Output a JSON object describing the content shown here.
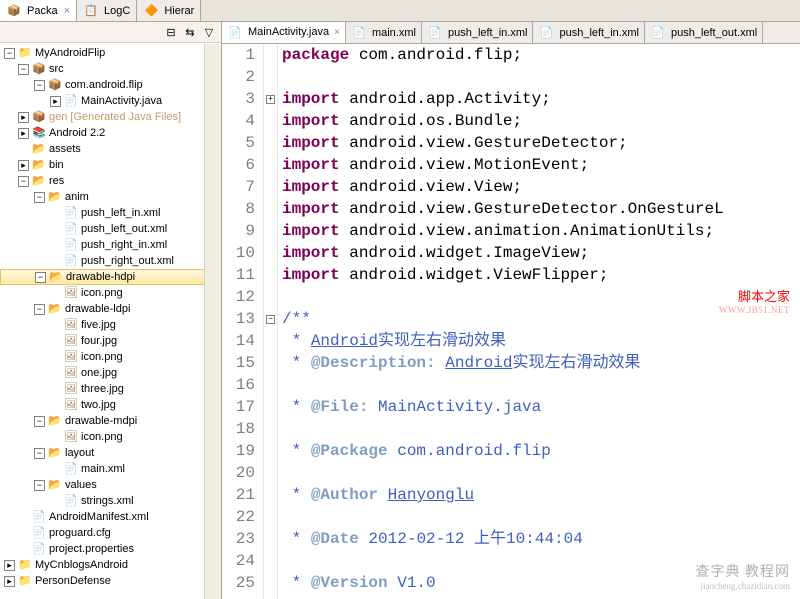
{
  "topTabs": [
    {
      "icon": "📦",
      "label": "Packa",
      "close": true
    },
    {
      "icon": "📋",
      "label": "LogC"
    },
    {
      "icon": "🔶",
      "label": "Hierar"
    }
  ],
  "tree": [
    {
      "d": 1,
      "exp": "-",
      "icon": "📁",
      "label": "MyAndroidFlip",
      "cls": "ico-proj"
    },
    {
      "d": 2,
      "exp": "-",
      "icon": "📦",
      "label": "src",
      "cls": "ico-pkg"
    },
    {
      "d": 3,
      "exp": "-",
      "icon": "📦",
      "label": "com.android.flip",
      "cls": "ico-pkg"
    },
    {
      "d": 4,
      "exp": ">",
      "icon": "📄",
      "label": "MainActivity.java",
      "cls": "ico-java"
    },
    {
      "d": 2,
      "exp": ">",
      "icon": "📦",
      "label": "gen [Generated Java Files]",
      "cls": "ico-pkg",
      "labelCls": "gen"
    },
    {
      "d": 2,
      "exp": ">",
      "icon": "📚",
      "label": "Android 2.2",
      "cls": "ico-folder"
    },
    {
      "d": 2,
      "exp": "",
      "icon": "📂",
      "label": "assets",
      "cls": "ico-folder"
    },
    {
      "d": 2,
      "exp": ">",
      "icon": "📂",
      "label": "bin",
      "cls": "ico-folder"
    },
    {
      "d": 2,
      "exp": "-",
      "icon": "📂",
      "label": "res",
      "cls": "ico-folder-open"
    },
    {
      "d": 3,
      "exp": "-",
      "icon": "📂",
      "label": "anim",
      "cls": "ico-folder-open"
    },
    {
      "d": 4,
      "exp": "",
      "icon": "📄",
      "label": "push_left_in.xml",
      "cls": "ico-xml"
    },
    {
      "d": 4,
      "exp": "",
      "icon": "📄",
      "label": "push_left_out.xml",
      "cls": "ico-xml"
    },
    {
      "d": 4,
      "exp": "",
      "icon": "📄",
      "label": "push_right_in.xml",
      "cls": "ico-xml"
    },
    {
      "d": 4,
      "exp": "",
      "icon": "📄",
      "label": "push_right_out.xml",
      "cls": "ico-xml"
    },
    {
      "d": 3,
      "exp": "-",
      "icon": "📂",
      "label": "drawable-hdpi",
      "cls": "ico-folder-open",
      "sel": true
    },
    {
      "d": 4,
      "exp": "",
      "icon": "🖼",
      "label": "icon.png",
      "cls": "ico-img"
    },
    {
      "d": 3,
      "exp": "-",
      "icon": "📂",
      "label": "drawable-ldpi",
      "cls": "ico-folder-open"
    },
    {
      "d": 4,
      "exp": "",
      "icon": "🖼",
      "label": "five.jpg",
      "cls": "ico-img"
    },
    {
      "d": 4,
      "exp": "",
      "icon": "🖼",
      "label": "four.jpg",
      "cls": "ico-img"
    },
    {
      "d": 4,
      "exp": "",
      "icon": "🖼",
      "label": "icon.png",
      "cls": "ico-img"
    },
    {
      "d": 4,
      "exp": "",
      "icon": "🖼",
      "label": "one.jpg",
      "cls": "ico-img"
    },
    {
      "d": 4,
      "exp": "",
      "icon": "🖼",
      "label": "three.jpg",
      "cls": "ico-img"
    },
    {
      "d": 4,
      "exp": "",
      "icon": "🖼",
      "label": "two.jpg",
      "cls": "ico-img"
    },
    {
      "d": 3,
      "exp": "-",
      "icon": "📂",
      "label": "drawable-mdpi",
      "cls": "ico-folder-open"
    },
    {
      "d": 4,
      "exp": "",
      "icon": "🖼",
      "label": "icon.png",
      "cls": "ico-img"
    },
    {
      "d": 3,
      "exp": "-",
      "icon": "📂",
      "label": "layout",
      "cls": "ico-folder-open"
    },
    {
      "d": 4,
      "exp": "",
      "icon": "📄",
      "label": "main.xml",
      "cls": "ico-xml"
    },
    {
      "d": 3,
      "exp": "-",
      "icon": "📂",
      "label": "values",
      "cls": "ico-folder-open"
    },
    {
      "d": 4,
      "exp": "",
      "icon": "📄",
      "label": "strings.xml",
      "cls": "ico-xml"
    },
    {
      "d": 2,
      "exp": "",
      "icon": "📄",
      "label": "AndroidManifest.xml",
      "cls": "ico-xml"
    },
    {
      "d": 2,
      "exp": "",
      "icon": "📄",
      "label": "proguard.cfg",
      "cls": "ico-file"
    },
    {
      "d": 2,
      "exp": "",
      "icon": "📄",
      "label": "project.properties",
      "cls": "ico-file"
    },
    {
      "d": 1,
      "exp": ">",
      "icon": "📁",
      "label": "MyCnblogsAndroid",
      "cls": "ico-proj"
    },
    {
      "d": 1,
      "exp": ">",
      "icon": "📁",
      "label": "PersonDefense",
      "cls": "ico-proj"
    }
  ],
  "editorTabs": [
    {
      "icon": "📄",
      "label": "MainActivity.java",
      "active": true,
      "close": true
    },
    {
      "icon": "📄",
      "label": "main.xml"
    },
    {
      "icon": "📄",
      "label": "push_left_in.xml"
    },
    {
      "icon": "📄",
      "label": "push_left_in.xml"
    },
    {
      "icon": "📄",
      "label": "push_left_out.xml"
    }
  ],
  "code": [
    {
      "n": 1,
      "html": "<span class='kw'>package</span> com.android.flip;"
    },
    {
      "n": 2,
      "html": ""
    },
    {
      "n": 3,
      "fold": "+",
      "html": "<span class='kw'>import</span> android.app.Activity;"
    },
    {
      "n": 4,
      "html": "<span class='kw'>import</span> android.os.Bundle;"
    },
    {
      "n": 5,
      "html": "<span class='kw'>import</span> android.view.GestureDetector;"
    },
    {
      "n": 6,
      "html": "<span class='kw'>import</span> android.view.MotionEvent;"
    },
    {
      "n": 7,
      "html": "<span class='kw'>import</span> android.view.View;"
    },
    {
      "n": 8,
      "html": "<span class='kw'>import</span> android.view.GestureDetector.OnGestureL"
    },
    {
      "n": 9,
      "html": "<span class='kw'>import</span> android.view.animation.AnimationUtils;"
    },
    {
      "n": 10,
      "html": "<span class='kw'>import</span> android.widget.ImageView;"
    },
    {
      "n": 11,
      "html": "<span class='kw'>import</span> android.widget.ViewFlipper;"
    },
    {
      "n": 12,
      "html": ""
    },
    {
      "n": 13,
      "fold": "-",
      "html": "<span class='com'>/**</span>"
    },
    {
      "n": 14,
      "html": "<span class='com'> * <span class='lnk'>Android</span>实现左右滑动效果</span>"
    },
    {
      "n": 15,
      "html": "<span class='com'> * <span class='tag'>@Description:</span> <span class='lnk'>Android</span>实现左右滑动效果</span>"
    },
    {
      "n": 16,
      "html": ""
    },
    {
      "n": 17,
      "html": "<span class='com'> * <span class='tag'>@File:</span> MainActivity.java</span>"
    },
    {
      "n": 18,
      "html": ""
    },
    {
      "n": 19,
      "html": "<span class='com'> * <span class='tag'>@Package</span> com.android.flip</span>"
    },
    {
      "n": 20,
      "html": ""
    },
    {
      "n": 21,
      "html": "<span class='com'> * <span class='tag'>@Author</span> <span class='lnk'>Hanyonglu</span></span>"
    },
    {
      "n": 22,
      "html": ""
    },
    {
      "n": 23,
      "html": "<span class='com'> * <span class='tag'>@Date</span> 2012-02-12 上午10:44:04</span>"
    },
    {
      "n": 24,
      "html": ""
    },
    {
      "n": 25,
      "html": "<span class='com'> * <span class='tag'>@Version</span> V1.0</span>"
    }
  ],
  "watermark1": {
    "line1": "脚本之家",
    "line2": "WWW.JB51.NET"
  },
  "watermark2": {
    "line1": "查字典 教程网",
    "line2": "jiaocheng.chazidian.com"
  }
}
